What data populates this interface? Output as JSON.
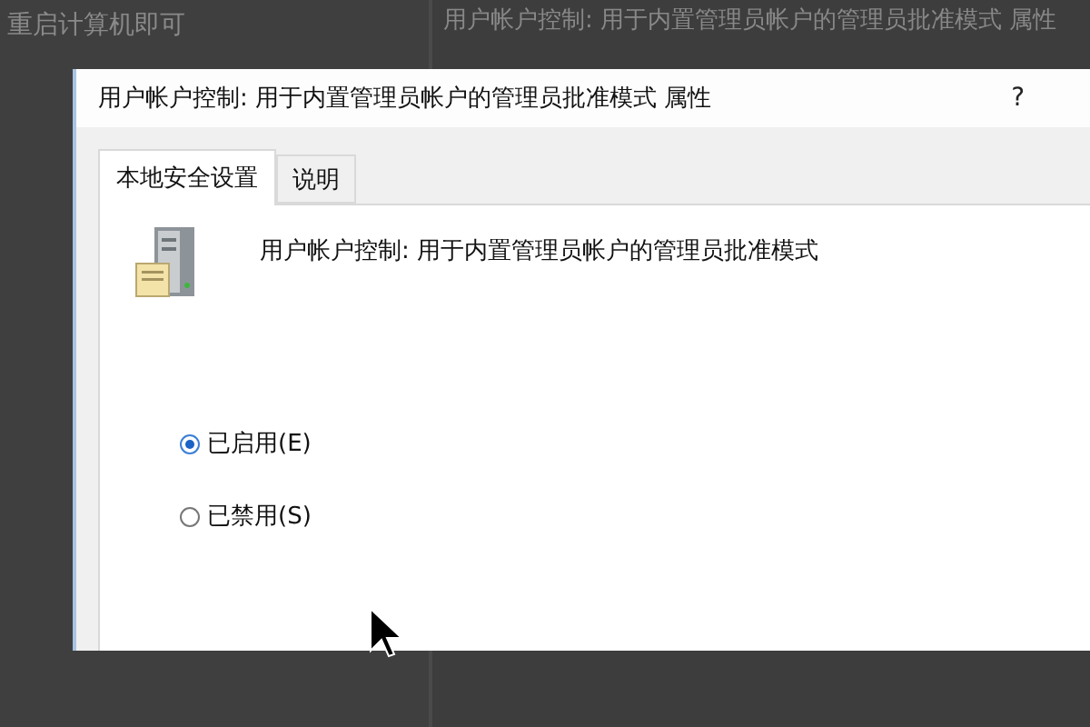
{
  "background": {
    "note": "重启计算机即可",
    "window_title": "用户帐户控制: 用于内置管理员帐户的管理员批准模式 属性"
  },
  "dialog": {
    "title": "用户帐户控制: 用于内置管理员帐户的管理员批准模式 属性",
    "help": "?",
    "tabs": [
      {
        "label": "本地安全设置",
        "selected": true
      },
      {
        "label": "说明",
        "selected": false
      }
    ],
    "policy_name": "用户帐户控制: 用于内置管理员帐户的管理员批准模式",
    "options": [
      {
        "label": "已启用(E)",
        "selected": true
      },
      {
        "label": "已禁用(S)",
        "selected": false
      }
    ]
  }
}
